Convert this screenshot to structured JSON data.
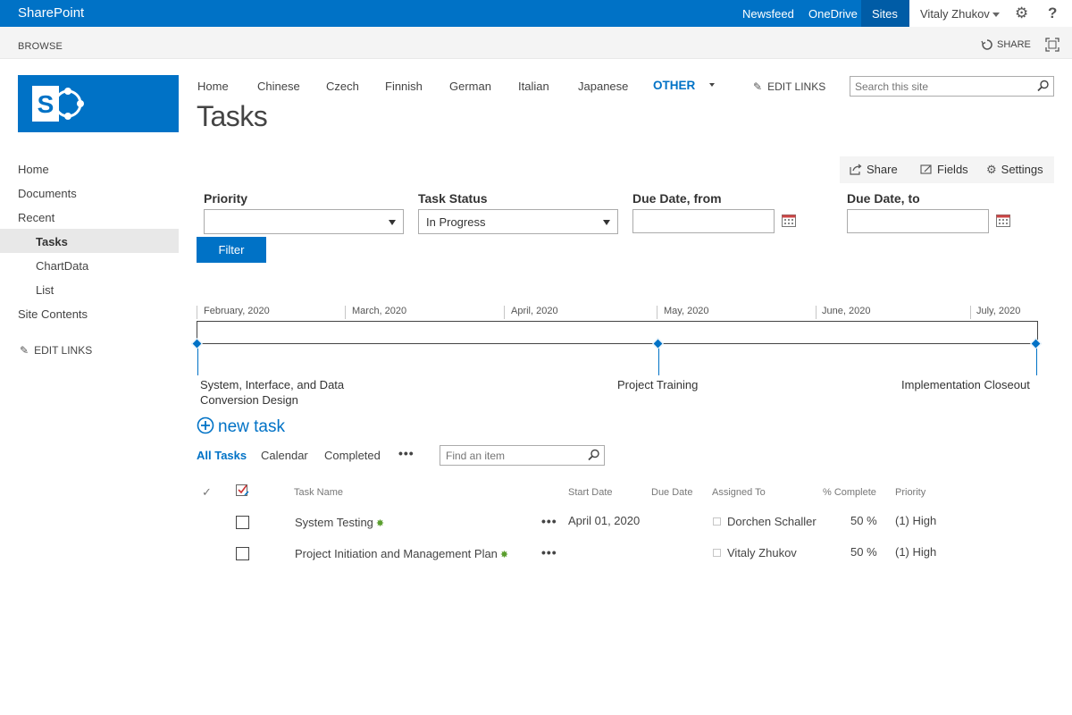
{
  "suitebar": {
    "brand": "SharePoint",
    "links": [
      "Newsfeed",
      "OneDrive",
      "Sites"
    ],
    "user": "Vitaly Zhukov",
    "help": "?",
    "bg_color": "#0072c6"
  },
  "ribbon": {
    "browse": "BROWSE",
    "share": "SHARE"
  },
  "topnav": {
    "items": [
      "Home",
      "Chinese",
      "Czech",
      "Finnish",
      "German",
      "Italian",
      "Japanese",
      "OTHER"
    ],
    "selected": "OTHER",
    "edit_links": "EDIT LINKS"
  },
  "search": {
    "placeholder": "Search this site"
  },
  "page": {
    "title": "Tasks"
  },
  "leftnav": {
    "items": [
      "Home",
      "Documents",
      "Recent",
      "Tasks",
      "ChartData",
      "List",
      "Site Contents"
    ],
    "selected": "Tasks",
    "edit_links": "EDIT LINKS"
  },
  "actions": {
    "share": "Share",
    "fields": "Fields",
    "settings": "Settings"
  },
  "filters": {
    "priority_label": "Priority",
    "priority_value": "",
    "status_label": "Task Status",
    "status_value": "In Progress",
    "due_from_label": "Due Date, from",
    "due_from_value": "",
    "due_to_label": "Due Date, to",
    "due_to_value": "",
    "filter_button": "Filter"
  },
  "timeline": {
    "months": [
      "February, 2020",
      "March, 2020",
      "April, 2020",
      "May, 2020",
      "June, 2020",
      "July, 2020"
    ],
    "milestones": [
      {
        "line1": "System, Interface, and Data",
        "line2": "Conversion Design"
      },
      {
        "line1": "Project Training",
        "line2": ""
      },
      {
        "line1": "Implementation Closeout",
        "line2": ""
      }
    ]
  },
  "list": {
    "new_task": "new task",
    "views": [
      "All Tasks",
      "Calendar",
      "Completed"
    ],
    "active_view": "All Tasks",
    "more": "•••",
    "find_placeholder": "Find an item",
    "columns": [
      "Task Name",
      "Start Date",
      "Due Date",
      "Assigned To",
      "% Complete",
      "Priority"
    ],
    "rows": [
      {
        "name": "System Testing",
        "start": "April 01, 2020",
        "due": "",
        "assigned": "Dorchen Schaller",
        "complete": "50 %",
        "priority": "(1) High"
      },
      {
        "name": "Project Initiation and Management Plan",
        "start": "",
        "due": "",
        "assigned": "Vitaly Zhukov",
        "complete": "50 %",
        "priority": "(1) High"
      }
    ]
  }
}
